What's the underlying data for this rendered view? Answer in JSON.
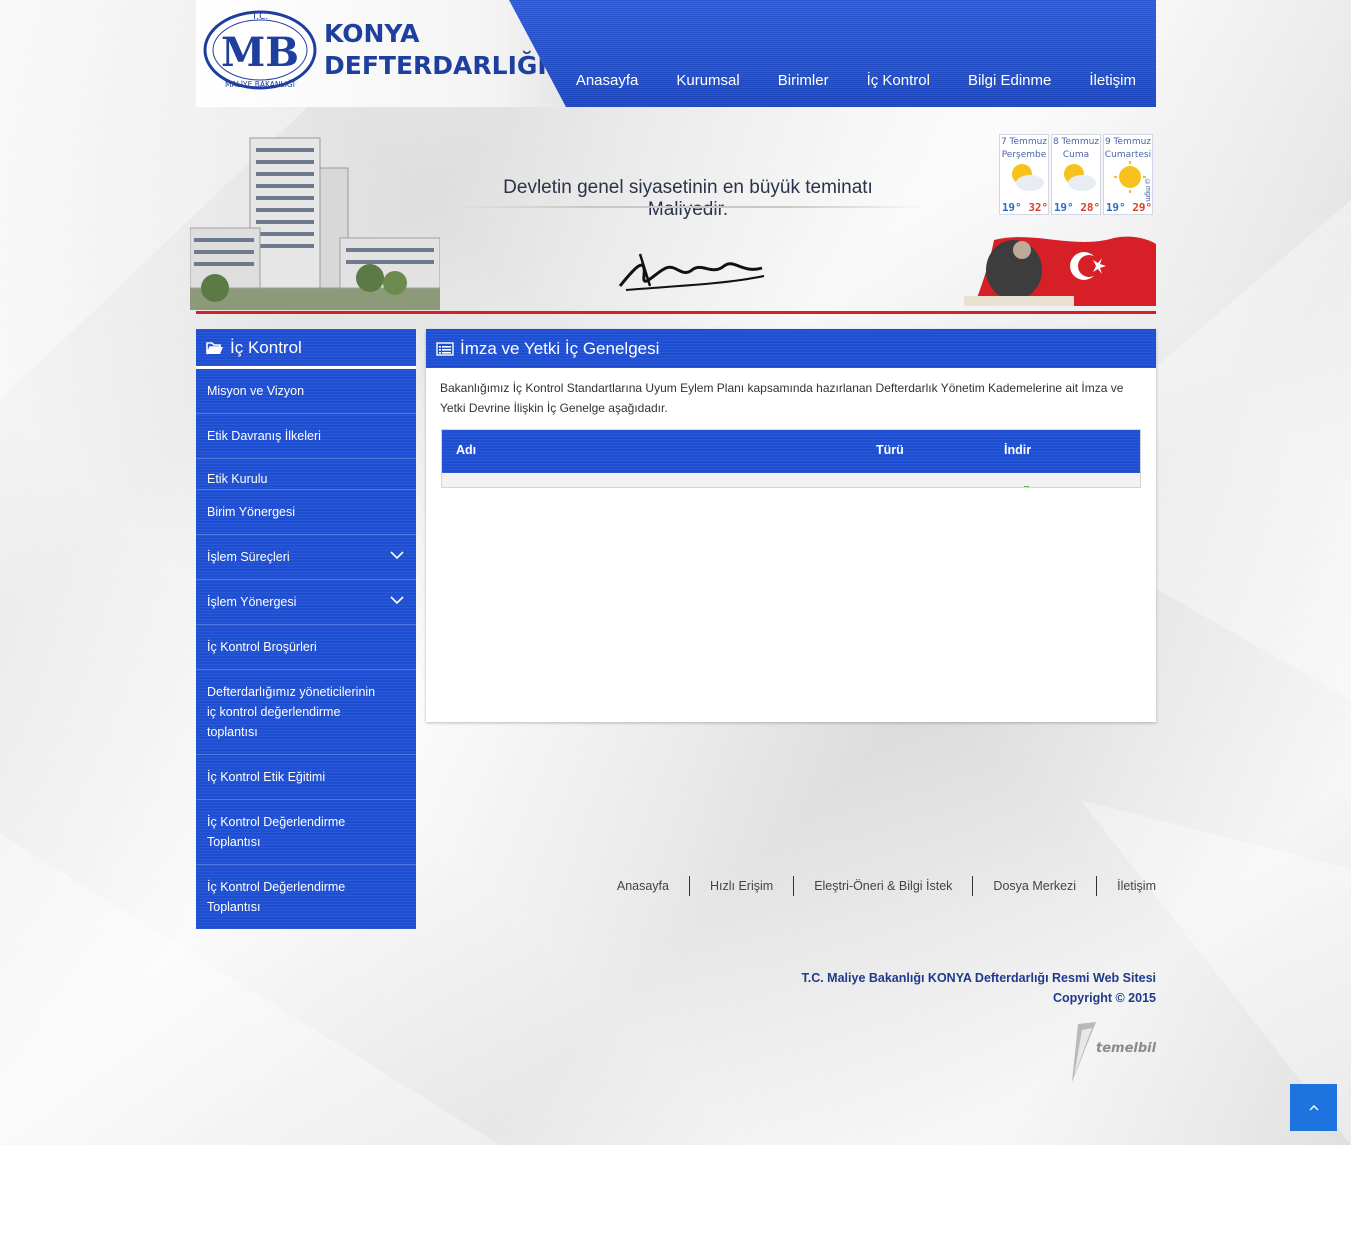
{
  "brand": {
    "line1": "KONYA",
    "line2": "DEFTERDARLIĞI",
    "logo_top": "T.C.",
    "logo_letters": "MB",
    "logo_bottom": "MALİYE BAKANLIĞI"
  },
  "nav": [
    "Anasayfa",
    "Kurumsal",
    "Birimler",
    "İç Kontrol",
    "Bilgi Edinme",
    "İletişim"
  ],
  "banner": {
    "motto": "Devletin genel siyasetinin en büyük teminatı Maliyedir."
  },
  "weather": {
    "days": [
      {
        "date": "7 Temmuz",
        "weekday": "Perşembe",
        "low": "19°",
        "high": "32°"
      },
      {
        "date": "8 Temmuz",
        "weekday": "Cuma",
        "low": "19°",
        "high": "28°"
      },
      {
        "date": "9 Temmuz",
        "weekday": "Cumartesi",
        "low": "19°",
        "high": "29°"
      }
    ],
    "tag": "©mgm"
  },
  "sidebar": {
    "title": "İç Kontrol",
    "items": [
      {
        "label": "Misyon ve Vizyon"
      },
      {
        "label": "Etik Davranış İlkeleri"
      },
      {
        "label": "Etik Kurulu"
      },
      {
        "label": "Birim Yönergesi"
      },
      {
        "label": "İşlem Süreçleri"
      },
      {
        "label": "İşlem Yönergesi"
      },
      {
        "label": "İç Kontrol Broşürleri"
      },
      {
        "label": "Defterdarlığımız yöneticilerinin iç kontrol değerlendirme toplantısı"
      },
      {
        "label": "İç Kontrol Etik Eğitimi"
      },
      {
        "label": "İç Kontrol Değerlendirme Toplantısı"
      },
      {
        "label": "İç Kontrol Değerlendirme Toplantısı"
      }
    ]
  },
  "main": {
    "title": "İmza ve Yetki İç Genelgesi",
    "description": "Bakanlığımız İç Kontrol Standartlarına Uyum Eylem Planı kapsamında hazırlanan Defterdarlık Yönetim Kademelerine ait İmza ve Yetki Devrine İlişkin İç Genelge aşağıdadır.",
    "table": {
      "headers": [
        "Adı",
        "Türü",
        "İndir"
      ]
    }
  },
  "footer": {
    "links": [
      "Anasayfa",
      "Hızlı Erişim",
      "Eleştri-Öneri & Bilgi İstek",
      "Dosya Merkezi",
      "İletişim"
    ],
    "copyright_line1": "T.C. Maliye Bakanlığı KONYA Defterdarlığı Resmi Web Sitesi",
    "copyright_line2": "Copyright © 2015",
    "vendor": "temelbilisim"
  },
  "colors": {
    "primary_blue": "#1e4ed2",
    "accent_red": "#d61f26",
    "top_button": "#1e74de"
  }
}
